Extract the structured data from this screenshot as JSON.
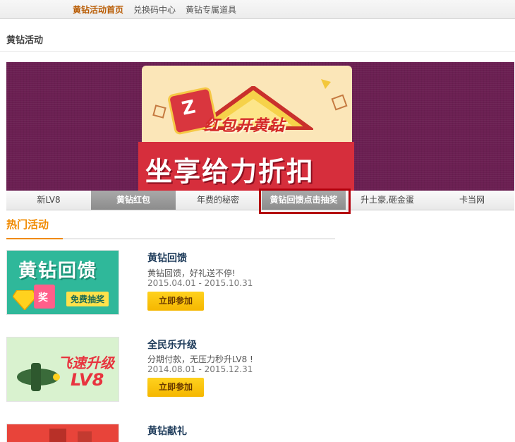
{
  "topnav": {
    "items": [
      {
        "label": "黄钻活动首页",
        "active": true
      },
      {
        "label": "兑换码中心",
        "active": false
      },
      {
        "label": "黄钻专属道具",
        "active": false
      }
    ]
  },
  "page": {
    "title": "黄钻活动"
  },
  "banner": {
    "sub_text": "红包开黄钻",
    "main_text": "坐享给力折扣",
    "fist_glyph": "Z"
  },
  "banner_tabs": [
    {
      "label": "新LV8",
      "state": "normal"
    },
    {
      "label": "黄钻红包",
      "state": "active"
    },
    {
      "label": "年费的秘密",
      "state": "normal"
    },
    {
      "label": "黄钻回馈点击抽奖",
      "state": "highlighted"
    },
    {
      "label": "升土豪,砸金蛋",
      "state": "normal"
    },
    {
      "label": "卡当网",
      "state": "normal"
    }
  ],
  "section": {
    "title": "热门活动"
  },
  "activities": [
    {
      "name": "黄钻回馈",
      "desc": "黄钻回馈，好礼送不停!",
      "date": "2015.04.01 - 2015.10.31",
      "button": "立即参加",
      "thumb": {
        "headline": "黄钻回馈",
        "badge": "免费抽奖",
        "bag_text": "奖",
        "bg": "#2fb89a"
      }
    },
    {
      "name": "全民乐升级",
      "desc": "分期付款，无压力秒升LV8 !",
      "date": "2014.08.01 - 2015.12.31",
      "button": "立即参加",
      "thumb": {
        "headline": "飞速升级",
        "sub": "LV8",
        "bg": "#d9f2cf"
      }
    },
    {
      "name": "黄钻献礼",
      "thumb": {
        "bg": "#e8443a"
      }
    }
  ]
}
